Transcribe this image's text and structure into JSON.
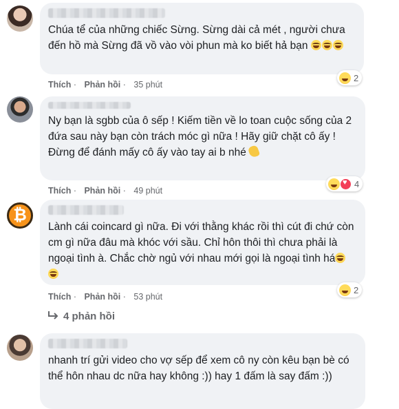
{
  "comments": [
    {
      "text": "Chúa tể của những chiếc Sừng. Sừng dài cả mét , người chưa đến hồ mà Sừng đã vồ vào vòi phun mà ko biết hả bạn",
      "like": "Thích",
      "reply": "Phản hồi",
      "time": "35 phút",
      "reaction_count": "2"
    },
    {
      "text": "Ny bạn là sgbb của ô sếp ! Kiếm tiền về lo toan cuộc sống của 2 đứa sau này bạn còn trách móc gì nữa ! Hãy giữ chặt cô ấy ! Đừng để đánh mấy cô ấy vào tay ai b nhé",
      "like": "Thích",
      "reply": "Phản hồi",
      "time": "49 phút",
      "reaction_count": "4"
    },
    {
      "text": "Lành cái coincard gì nữa. Đi với thằng khác rồi thì cút đi chứ còn cm gì nữa đâu mà khóc với sầu. Chỉ hôn thôi thì chưa phải là ngoại tình à. Chắc chờ ngủ với nhau mới gọi là ngoại tình há",
      "like": "Thích",
      "reply": "Phản hồi",
      "time": "53 phút",
      "reaction_count": "2",
      "replies_label": "4 phản hồi"
    },
    {
      "text": "nhanh trí gửi video cho vợ sếp để xem cô ny còn kêu bạn bè có thể hôn nhau dc nữa hay không :)) hay 1 đấm là say đấm :))"
    }
  ],
  "icons": {
    "laugh": "laughing-emoji-icon",
    "love": "heart-reaction-icon",
    "reply_arrow": "reply-arrow-icon",
    "bitcoin": "bitcoin-icon"
  }
}
